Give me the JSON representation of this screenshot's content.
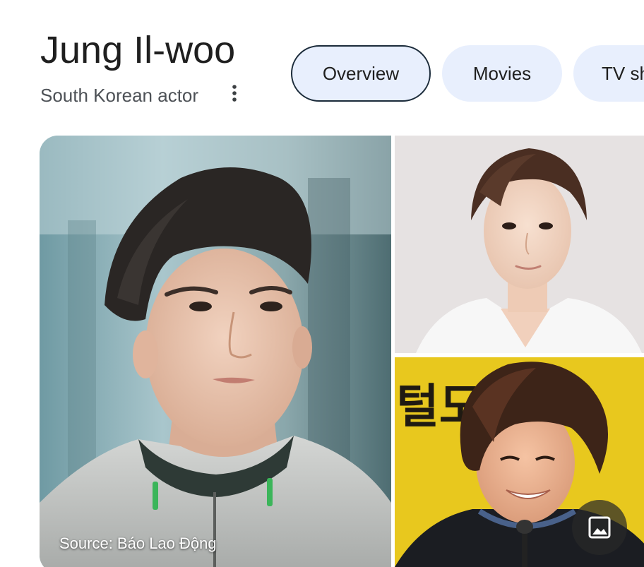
{
  "header": {
    "title": "Jung Il-woo",
    "subtitle": "South Korean actor"
  },
  "tabs": [
    {
      "label": "Overview",
      "active": true
    },
    {
      "label": "Movies",
      "active": false
    },
    {
      "label": "TV sh",
      "active": false
    }
  ],
  "gallery": {
    "source": "Source: Báo Lao Động",
    "sign_text": "털도"
  },
  "icons": {
    "more": "more-vert-icon",
    "images": "image-icon"
  },
  "colors": {
    "tab_bg": "#e8effd",
    "tab_active_border": "#1b2b3a",
    "title": "#1f1f1f",
    "subtitle": "#4d5156",
    "poster_yellow": "#e8c81e"
  }
}
